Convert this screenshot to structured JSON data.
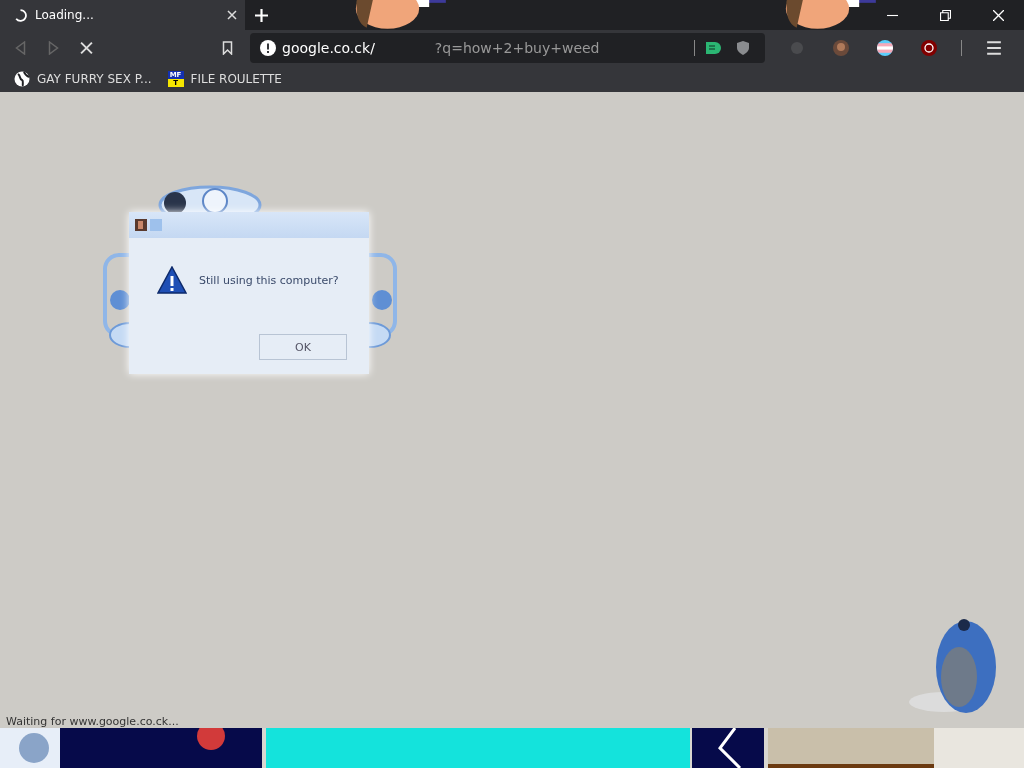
{
  "tabs": [
    {
      "title": "Loading...",
      "selected": true,
      "loading": true
    }
  ],
  "address": {
    "host": "google.co.ck/",
    "query": "?q=how+2+buy+weed"
  },
  "bookmarks": [
    {
      "kind": "globe",
      "label": "GAY FURRY SEX P..."
    },
    {
      "kind": "badge",
      "icon_top": "MF",
      "icon_bottom": "T",
      "label": "FILE ROULETTE"
    }
  ],
  "dialog": {
    "message": "Still using this computer?",
    "button": "OK"
  },
  "status_bar": {
    "text": "Waiting for www.google.co.ck..."
  }
}
